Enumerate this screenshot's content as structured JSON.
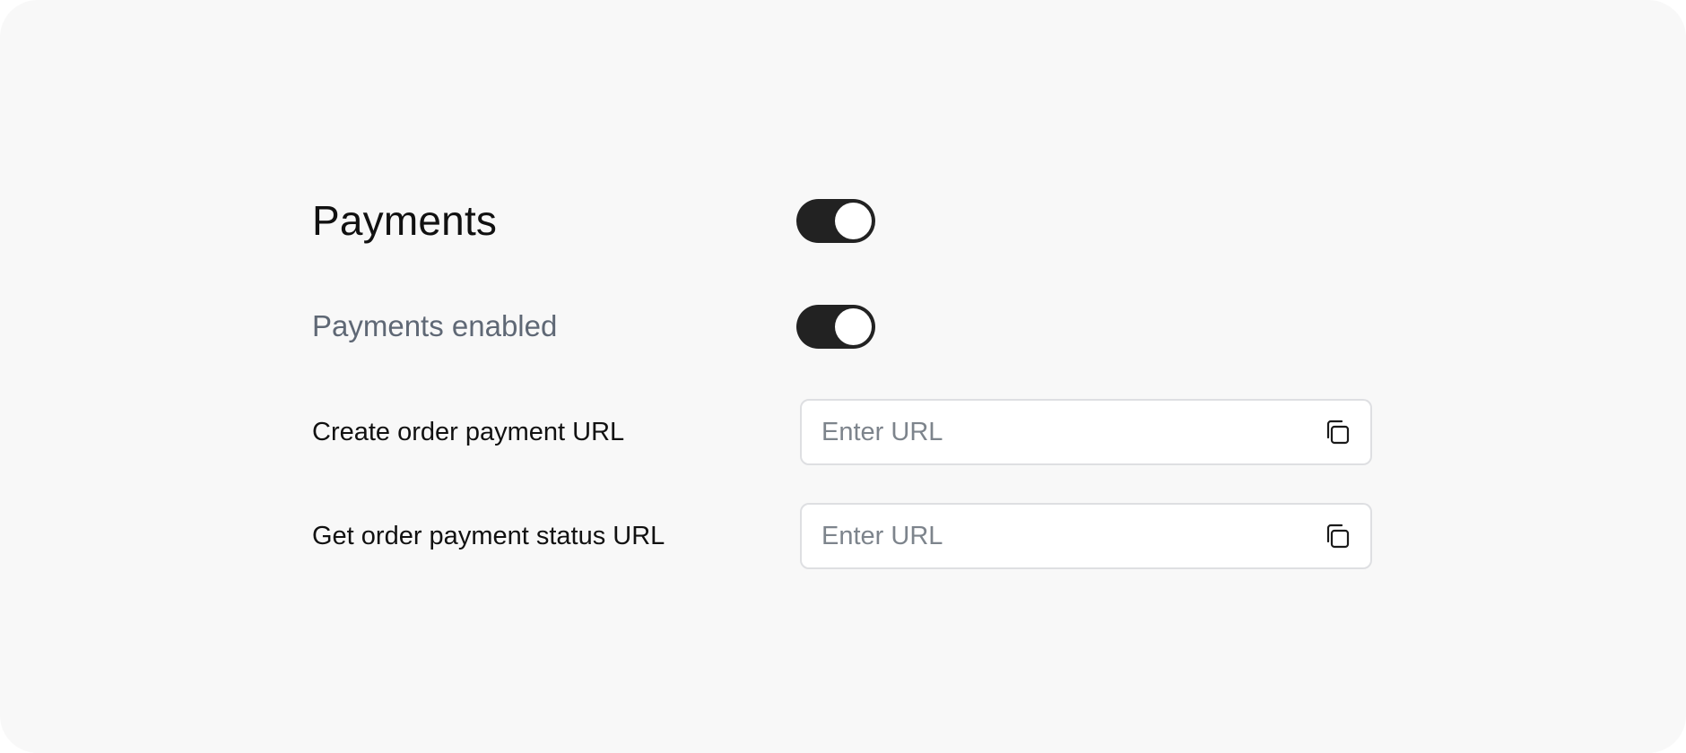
{
  "payments": {
    "title": "Payments",
    "master_toggle": {
      "on": true
    },
    "enabled_label": "Payments enabled",
    "enabled_toggle": {
      "on": true
    },
    "fields": [
      {
        "label": "Create order payment URL",
        "value": "",
        "placeholder": "Enter URL",
        "icon": "copy-icon"
      },
      {
        "label": "Get order payment status URL",
        "value": "",
        "placeholder": "Enter URL",
        "icon": "copy-icon"
      }
    ]
  },
  "colors": {
    "panel_background": "#f8f8f8",
    "toggle_on": "#222222",
    "toggle_knob": "#ffffff",
    "muted_text": "#5f6875",
    "placeholder_text": "#7d848c",
    "input_border": "#dedfe2"
  }
}
